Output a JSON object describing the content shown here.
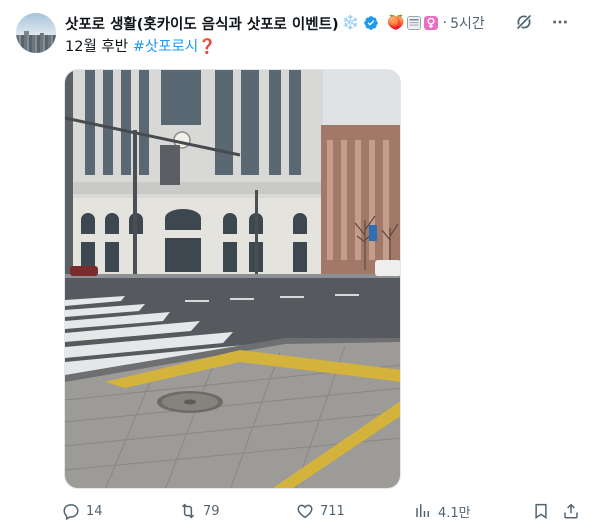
{
  "author": {
    "display_name": "삿포로 생활(홋카이도 음식과 삿포로 이벤트)",
    "snowflake_emoji": "❄️",
    "badge_emoji": "🍑"
  },
  "post": {
    "time": "5시간",
    "separator": "·",
    "text_prefix": "12월 후반 ",
    "hashtag": "#삿포로시",
    "text_suffix": "❓"
  },
  "actions": {
    "replies": "14",
    "reposts": "79",
    "likes": "711",
    "views": "4.1만"
  },
  "colors": {
    "accent": "#1d9bf0",
    "muted": "#536471",
    "text": "#0f1419"
  }
}
